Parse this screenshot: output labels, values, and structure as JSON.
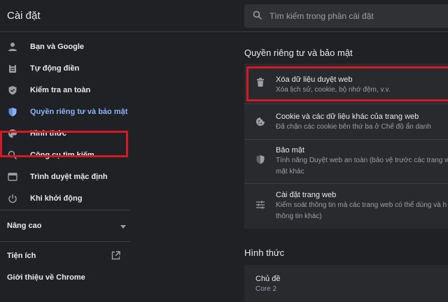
{
  "app": {
    "title": "Cài đặt"
  },
  "search": {
    "placeholder": "Tìm kiếm trong phần cài đặt",
    "icon": "search-icon"
  },
  "sidebar": {
    "items": [
      {
        "label": "Bạn và Google",
        "icon": "person-icon"
      },
      {
        "label": "Tự động điền",
        "icon": "clipboard-icon"
      },
      {
        "label": "Kiểm tra an toàn",
        "icon": "shield-check-icon"
      },
      {
        "label": "Quyền riêng tư và bảo mật",
        "icon": "shield-icon",
        "active": true
      },
      {
        "label": "Hình thức",
        "icon": "palette-icon"
      },
      {
        "label": "Công cụ tìm kiếm",
        "icon": "search-icon"
      },
      {
        "label": "Trình duyệt mặc định",
        "icon": "browser-icon"
      },
      {
        "label": "Khi khởi động",
        "icon": "power-icon"
      }
    ],
    "advanced": {
      "label": "Nâng cao",
      "icon": "chevron-down-icon"
    },
    "extensions": {
      "label": "Tiện ích",
      "icon": "open-external-icon"
    },
    "about": {
      "label": "Giới thiệu về Chrome"
    }
  },
  "main": {
    "privacy_section": {
      "title": "Quyền riêng tư và bảo mật",
      "rows": [
        {
          "title": "Xóa dữ liệu duyệt web",
          "subtitle": "Xóa lịch sử, cookie, bộ nhớ đệm, v.v.",
          "icon": "trash-icon"
        },
        {
          "title": "Cookie và các dữ liệu khác của trang web",
          "subtitle": "Đã chặn các cookie bên thứ ba ở Chế độ ẩn danh",
          "icon": "cookie-icon"
        },
        {
          "title": "Bảo mật",
          "subtitle_line1": "Tính năng Duyệt web an toàn (bảo vệ trước các trang w",
          "subtitle_line2": "mặt khác",
          "icon": "shield-icon"
        },
        {
          "title": "Cài đặt trang web",
          "subtitle_line1": "Kiểm soát thông tin mà các trang web có thể dùng và h",
          "subtitle_line2": "thông tin khác)",
          "icon": "tune-icon"
        }
      ]
    },
    "appearance_section": {
      "title": "Hình thức",
      "theme": {
        "title": "Chủ đề",
        "value": "Core 2"
      }
    }
  },
  "colors": {
    "background": "#202124",
    "card": "#292a2d",
    "accent": "#8ab4f8",
    "highlight": "#d21b26"
  }
}
